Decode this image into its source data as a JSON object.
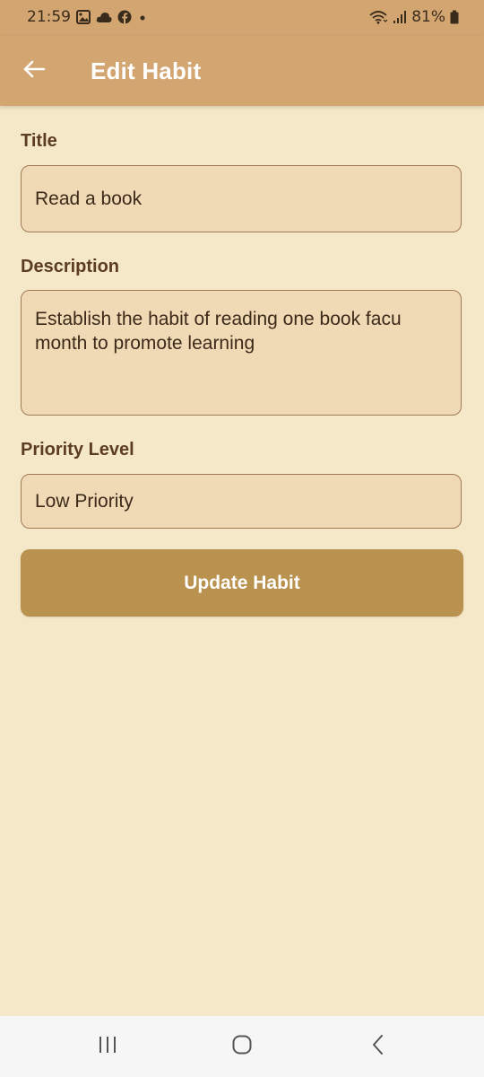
{
  "status_bar": {
    "time": "21:59",
    "battery": "81%",
    "left_icons": [
      "gallery-icon",
      "cloud-icon",
      "facebook-icon",
      "notification-dot-icon"
    ],
    "right_icons": [
      "wifi-icon",
      "signal-icon",
      "battery-icon"
    ]
  },
  "app_bar": {
    "title": "Edit Habit",
    "back_icon": "arrow-left-icon"
  },
  "form": {
    "title_label": "Title",
    "title_value": "Read a book",
    "description_label": "Description",
    "description_value": "Establish the habit of reading one book facu month to promote learning",
    "priority_label": "Priority Level",
    "priority_value": "Low Priority",
    "submit_label": "Update Habit"
  },
  "nav_bar": {
    "buttons": [
      "recent-apps-icon",
      "home-icon",
      "back-icon"
    ]
  },
  "colors": {
    "app_bar": "#D2A571",
    "background": "#F5E8C8",
    "field_fill": "#F0D9B5",
    "field_border": "#A07A55",
    "label": "#5C3D22",
    "button": "#B8924E"
  }
}
